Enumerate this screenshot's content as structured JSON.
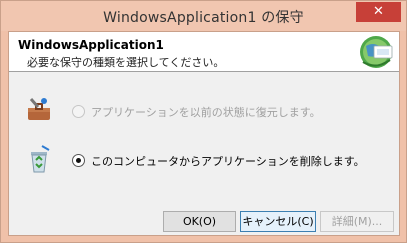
{
  "window": {
    "title": "WindowsApplication1 の保守",
    "close_glyph": "✕"
  },
  "header": {
    "app_name": "WindowsApplication1",
    "instruction": "必要な保守の種類を選択してください。",
    "icon": "install-globe-icon"
  },
  "options": [
    {
      "label": "アプリケーションを以前の状態に復元します。",
      "icon": "restore-toolbox-icon",
      "selected": false,
      "enabled": false
    },
    {
      "label": "このコンピュータからアプリケーションを削除します。",
      "icon": "recycle-bin-icon",
      "selected": true,
      "enabled": true
    }
  ],
  "buttons": {
    "ok": "OK(O)",
    "cancel": "キャンセル(C)",
    "details": "詳細(M)..."
  },
  "colors": {
    "title_bar": "#f1c6b0",
    "close_button": "#c74038",
    "focus_border": "#3c7fb1"
  }
}
